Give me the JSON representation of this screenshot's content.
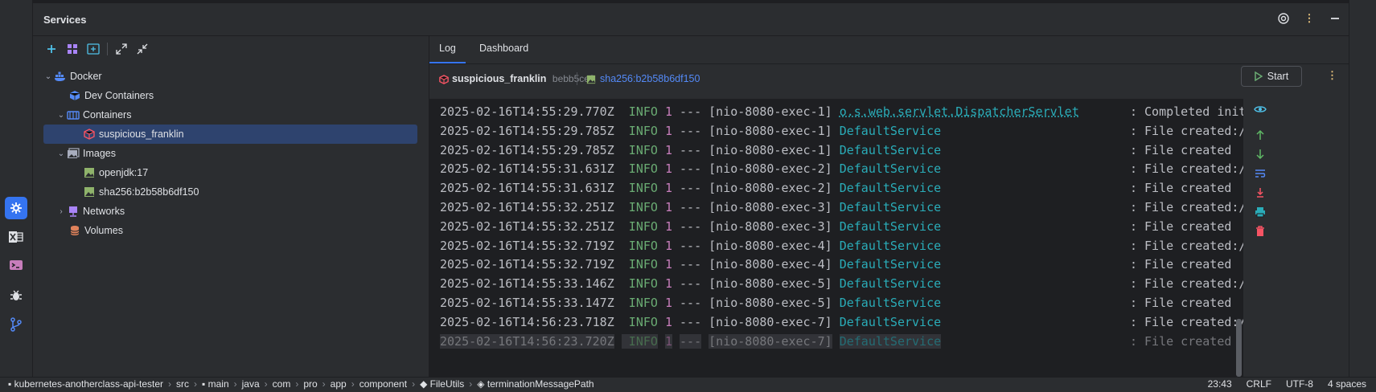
{
  "panel": {
    "title": "Services"
  },
  "tree": {
    "items": [
      {
        "label": "Docker",
        "level": 0,
        "expanded": true,
        "icon": "docker-icon"
      },
      {
        "label": "Dev Containers",
        "level": 1,
        "icon": "cube-icon"
      },
      {
        "label": "Containers",
        "level": 1,
        "expanded": true,
        "icon": "containers-icon"
      },
      {
        "label": "suspicious_franklin",
        "level": 2,
        "selected": true,
        "icon": "container-icon"
      },
      {
        "label": "Images",
        "level": 1,
        "expanded": true,
        "icon": "images-icon"
      },
      {
        "label": "openjdk:17",
        "level": 2,
        "icon": "image-icon"
      },
      {
        "label": "sha256:b2b58b6df150",
        "level": 2,
        "icon": "image-icon"
      },
      {
        "label": "Networks",
        "level": 1,
        "expanded": false,
        "icon": "network-icon"
      },
      {
        "label": "Volumes",
        "level": 1,
        "icon": "volume-icon"
      }
    ]
  },
  "log": {
    "tabs": [
      {
        "label": "Log",
        "active": true
      },
      {
        "label": "Dashboard"
      }
    ],
    "container_name": "suspicious_franklin",
    "container_hash": "bebb5ce9",
    "image_ref": "sha256:b2b58b6df150",
    "start_label": "Start",
    "lines": [
      {
        "ts": "2025-02-16T14:55:29.770Z",
        "level": "INFO",
        "pid": "1",
        "sep": "---",
        "thread": "[nio-8080-exec-1]",
        "logger": "o.s.web.servlet.DispatcherServlet",
        "pad": "       ",
        "msg": ": Completed initializatio"
      },
      {
        "ts": "2025-02-16T14:55:29.785Z",
        "level": "INFO",
        "pid": "1",
        "sep": "---",
        "thread": "[nio-8080-exec-1]",
        "logger": "DefaultService",
        "pad": "                          ",
        "msg": ": File created:/usr/src/m"
      },
      {
        "ts": "2025-02-16T14:55:29.785Z",
        "level": "INFO",
        "pid": "1",
        "sep": "---",
        "thread": "[nio-8080-exec-1]",
        "logger": "DefaultService",
        "pad": "                          ",
        "msg": ": File created"
      },
      {
        "ts": "2025-02-16T14:55:31.631Z",
        "level": "INFO",
        "pid": "1",
        "sep": "---",
        "thread": "[nio-8080-exec-2]",
        "logger": "DefaultService",
        "pad": "                          ",
        "msg": ": File created:/usr/src/m"
      },
      {
        "ts": "2025-02-16T14:55:31.631Z",
        "level": "INFO",
        "pid": "1",
        "sep": "---",
        "thread": "[nio-8080-exec-2]",
        "logger": "DefaultService",
        "pad": "                          ",
        "msg": ": File created"
      },
      {
        "ts": "2025-02-16T14:55:32.251Z",
        "level": "INFO",
        "pid": "1",
        "sep": "---",
        "thread": "[nio-8080-exec-3]",
        "logger": "DefaultService",
        "pad": "                          ",
        "msg": ": File created:/usr/src/m"
      },
      {
        "ts": "2025-02-16T14:55:32.251Z",
        "level": "INFO",
        "pid": "1",
        "sep": "---",
        "thread": "[nio-8080-exec-3]",
        "logger": "DefaultService",
        "pad": "                          ",
        "msg": ": File created"
      },
      {
        "ts": "2025-02-16T14:55:32.719Z",
        "level": "INFO",
        "pid": "1",
        "sep": "---",
        "thread": "[nio-8080-exec-4]",
        "logger": "DefaultService",
        "pad": "                          ",
        "msg": ": File created:/usr/src/m"
      },
      {
        "ts": "2025-02-16T14:55:32.719Z",
        "level": "INFO",
        "pid": "1",
        "sep": "---",
        "thread": "[nio-8080-exec-4]",
        "logger": "DefaultService",
        "pad": "                          ",
        "msg": ": File created"
      },
      {
        "ts": "2025-02-16T14:55:33.146Z",
        "level": "INFO",
        "pid": "1",
        "sep": "---",
        "thread": "[nio-8080-exec-5]",
        "logger": "DefaultService",
        "pad": "                          ",
        "msg": ": File created:/usr/src/m"
      },
      {
        "ts": "2025-02-16T14:55:33.147Z",
        "level": "INFO",
        "pid": "1",
        "sep": "---",
        "thread": "[nio-8080-exec-5]",
        "logger": "DefaultService",
        "pad": "                          ",
        "msg": ": File created"
      },
      {
        "ts": "2025-02-16T14:56:23.718Z",
        "level": "INFO",
        "pid": "1",
        "sep": "---",
        "thread": "[nio-8080-exec-7]",
        "logger": "DefaultService",
        "pad": "                          ",
        "msg": ": File created:/usr/src/m"
      },
      {
        "ts": "2025-02-16T14:56:23.720Z",
        "level": "INFO",
        "pid": "1",
        "sep": "---",
        "thread": "[nio-8080-exec-7]",
        "logger": "DefaultService",
        "pad": "                          ",
        "msg": ": File created"
      }
    ]
  },
  "statusbar": {
    "breadcrumbs": [
      "kubernetes-anotherclass-api-tester",
      "src",
      "main",
      "java",
      "com",
      "pro",
      "app",
      "component",
      "FileUtils",
      "terminationMessagePath"
    ],
    "position": "23:43",
    "line_ending": "CRLF",
    "encoding": "UTF-8",
    "indent": "4 spaces"
  },
  "colors": {
    "accent": "#3574f0",
    "selection": "#2e436e",
    "log_level": "#6aab73",
    "logger": "#2aacb8",
    "pid": "#c77dbb"
  }
}
